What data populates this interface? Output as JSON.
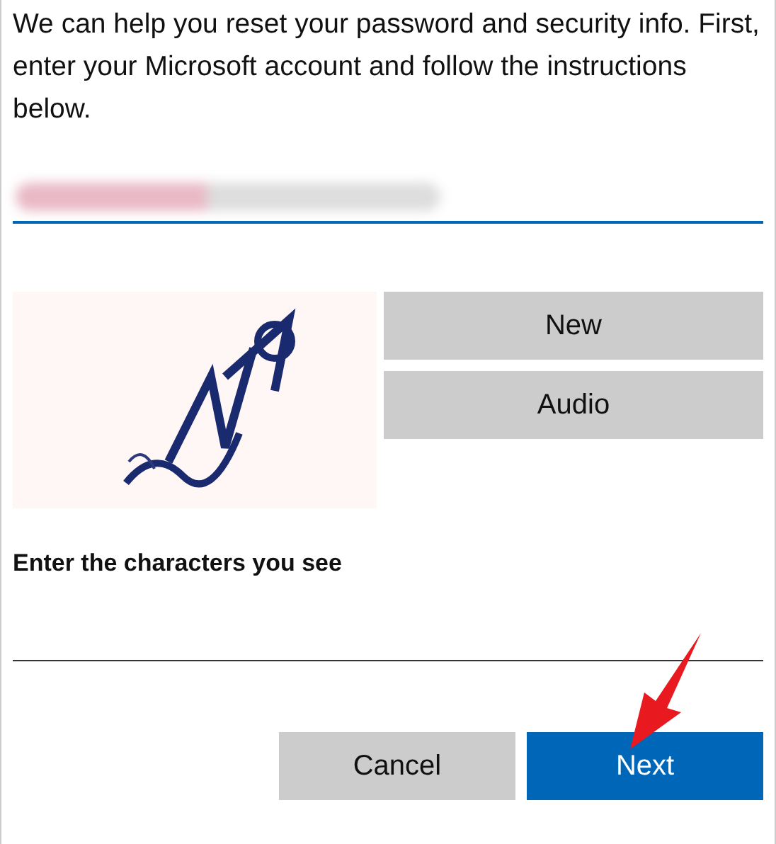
{
  "intro": "We can help you reset your password and security info. First, enter your Microsoft account and follow the instructions below.",
  "account_field": {
    "focused": true,
    "value_blurred": true
  },
  "captcha_buttons": [
    "New",
    "Audio"
  ],
  "answer_label": "Enter the characters you see",
  "answer_field": {
    "focused": false
  },
  "buttons": [
    {
      "label": "Cancel",
      "kind": "secondary"
    },
    {
      "label": "Next",
      "kind": "primary"
    }
  ],
  "annotation": {
    "kind": "arrow"
  }
}
